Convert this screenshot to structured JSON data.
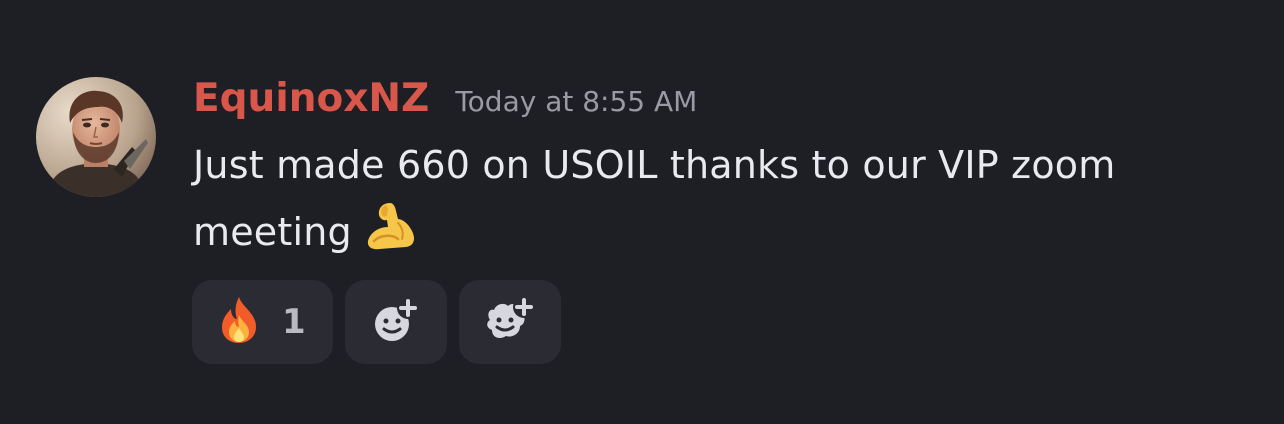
{
  "message": {
    "author": "EquinoxNZ",
    "timestamp": "Today at 8:55 AM",
    "text": "Just made 660 on USOIL thanks to our VIP zoom meeting",
    "inline_emoji": "flexed-biceps",
    "author_color": "#d9574a"
  },
  "reactions": [
    {
      "emoji": "fire",
      "count": "1"
    },
    {
      "icon": "add-reaction"
    },
    {
      "icon": "add-super-reaction"
    }
  ],
  "colors": {
    "background": "#1e1e25",
    "reaction_bg": "#2b2c33",
    "text": "#e9e9ef",
    "timestamp": "#9a9aa4"
  }
}
